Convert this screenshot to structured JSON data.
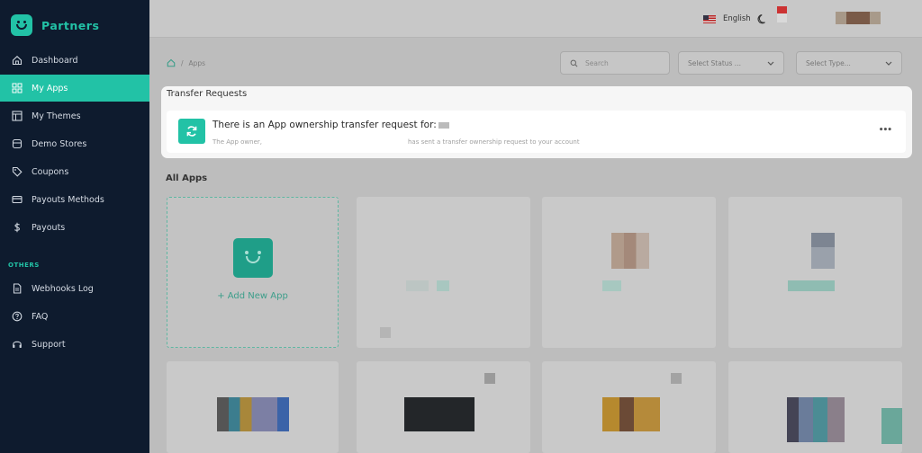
{
  "brand": {
    "name": "Partners"
  },
  "sidebar": {
    "items": [
      {
        "label": "Dashboard",
        "icon": "home-icon"
      },
      {
        "label": "My Apps",
        "icon": "grid-icon",
        "active": true
      },
      {
        "label": "My Themes",
        "icon": "layout-icon"
      },
      {
        "label": "Demo Stores",
        "icon": "store-icon"
      },
      {
        "label": "Coupons",
        "icon": "tag-icon"
      },
      {
        "label": "Payouts Methods",
        "icon": "credit-card-icon"
      },
      {
        "label": "Payouts",
        "icon": "dollar-icon"
      }
    ],
    "section_label": "OTHERS",
    "other_items": [
      {
        "label": "Webhooks Log",
        "icon": "document-icon"
      },
      {
        "label": "FAQ",
        "icon": "help-icon"
      },
      {
        "label": "Support",
        "icon": "headset-icon"
      }
    ]
  },
  "header": {
    "language": "English"
  },
  "breadcrumb": {
    "current": "Apps",
    "separator": "/"
  },
  "filters": {
    "search_placeholder": "Search",
    "status_placeholder": "Select Status ...",
    "type_placeholder": "Select Type..."
  },
  "transfer": {
    "heading": "Transfer Requests",
    "request_title": "There is an App ownership transfer request for:",
    "request_text_prefix": "The App owner,",
    "request_text_suffix": "has sent a transfer ownership request to your account",
    "more_label": "•••"
  },
  "apps": {
    "heading": "All Apps",
    "add_label": "+ Add New App"
  },
  "colors": {
    "accent": "#22c2a6",
    "sidebar_bg": "#0e1b2e"
  }
}
